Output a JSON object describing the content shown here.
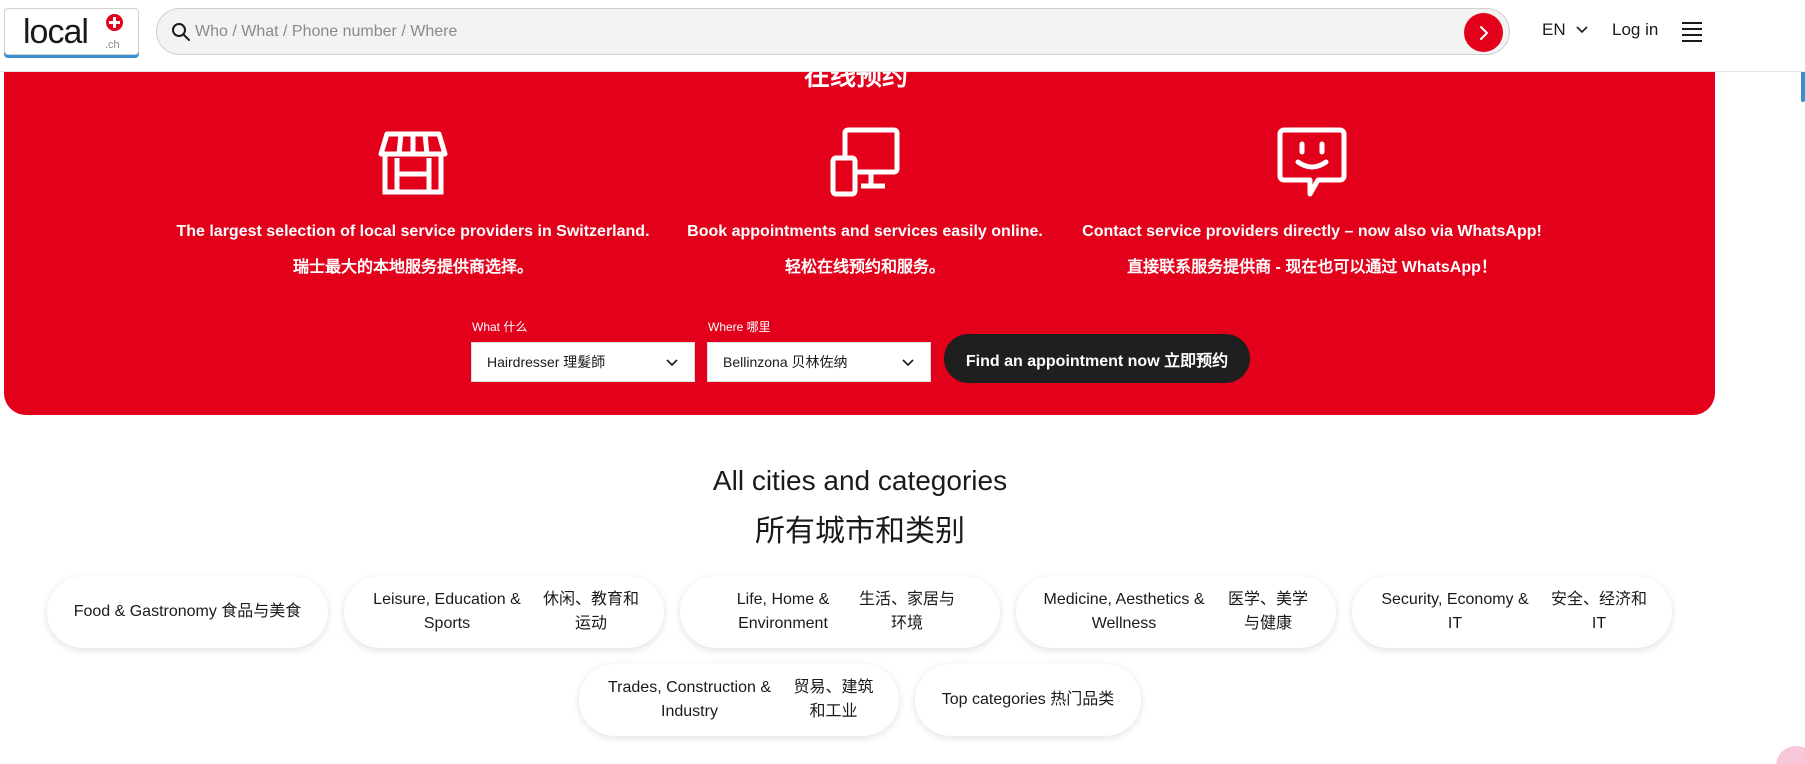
{
  "header": {
    "logo_text": "local",
    "logo_tld": ".ch",
    "search_placeholder": "Who / What / Phone number / Where",
    "lang": "EN",
    "login": "Log in"
  },
  "hero": {
    "title_partial": "在线预约",
    "features": [
      {
        "icon": "store-icon",
        "en": "The largest selection of local service providers in Switzerland.",
        "zh": "瑞士最大的本地服务提供商选择。"
      },
      {
        "icon": "devices-icon",
        "en": "Book appointments and services easily online.",
        "zh": "轻松在线预约和服务。"
      },
      {
        "icon": "chat-smiley-icon",
        "en": "Contact service providers directly – now also via WhatsApp!",
        "zh": "直接联系服务提供商 - 现在也可以通过 WhatsApp！"
      }
    ],
    "what_label": "What 什么",
    "what_value": "Hairdresser 理髮師",
    "where_label": "Where 哪里",
    "where_value": "Bellinzona 贝林佐纳",
    "find_button": "Find an appointment now 立即预约"
  },
  "categories": {
    "title_en": "All cities and categories",
    "title_zh": "所有城市和类别",
    "chips": [
      {
        "en": "Food & Gastronomy 食品与美食",
        "zh": ""
      },
      {
        "en": "Leisure, Education & Sports",
        "zh": "休闲、教育和运动"
      },
      {
        "en": "Life, Home & Environment",
        "zh": "生活、家居与环境"
      },
      {
        "en": "Medicine, Aesthetics & Wellness",
        "zh": "医学、美学与健康"
      },
      {
        "en": "Security, Economy & IT",
        "zh": "安全、经济和IT"
      },
      {
        "en": "Trades, Construction & Industry",
        "zh": "贸易、建筑和工业"
      },
      {
        "en": "Top categories 热门品类",
        "zh": ""
      }
    ]
  },
  "colors": {
    "brand_red": "#e2001a",
    "button_dark": "#1f1f1f"
  }
}
